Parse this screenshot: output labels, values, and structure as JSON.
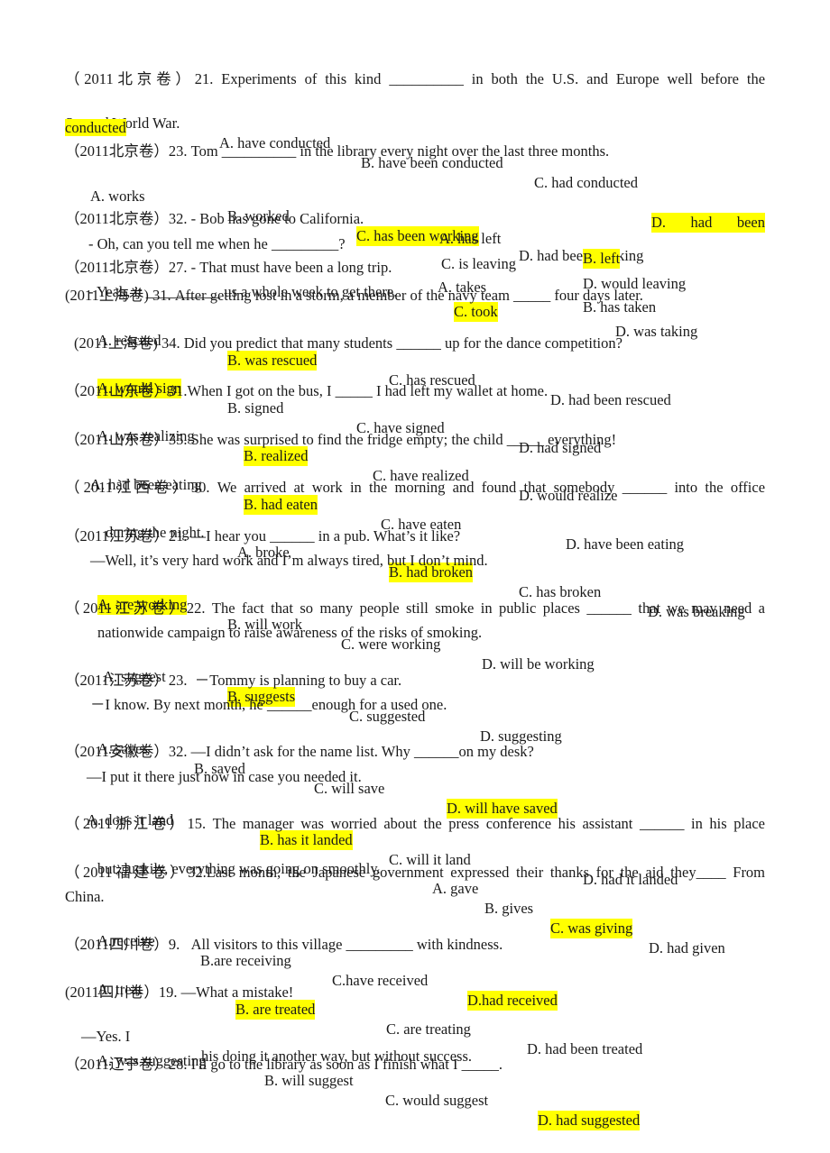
{
  "document": {
    "questions": [
      {
        "source": "（2011北京卷）",
        "number": "21.",
        "stem_before": "Experiments of this kind",
        "blank": "__________",
        "stem_after": "in both the U.S. and Europe well before the",
        "stem_line2": "Second World War.",
        "options": [
          "A. have conducted",
          "B. have been conducted",
          "C. had conducted",
          "D.    had    been",
          "conducted"
        ],
        "answer": "D"
      },
      {
        "source": "（2011北京卷）",
        "number": "23.",
        "stem_before": "Tom",
        "blank": "__________",
        "stem_after": "in the library every night over the last three months.",
        "options": [
          "A. works",
          "B. worked",
          "C. has been working",
          "D. had been working"
        ],
        "answer": "C"
      },
      {
        "source": "（2011北京卷）",
        "number": "32.",
        "stem_before": "- Bob has gone to California.",
        "stem_line2_before": "- Oh, can you tell me when he",
        "blank": "_________",
        "stem_line2_after": "?",
        "options": [
          "A. has left",
          "B. left",
          "C. is leaving",
          "D. would leaving"
        ],
        "answer": "B"
      },
      {
        "source": "（2011北京卷）",
        "number": "27.",
        "stem_before": "- That must have been a long trip.",
        "stem_line2_before": "- Yeah, it",
        "blank": "__________",
        "stem_line2_after": "us a whole week to get there.",
        "options": [
          "A. takes",
          "B. has taken",
          "C. took",
          "D. was taking"
        ],
        "answer": "C"
      },
      {
        "source": "(2011上海卷)",
        "number": "31.",
        "stem_before": "After getting lost in a storm, a member of the navy team",
        "blank": "_____",
        "stem_after": "four days later.",
        "options": [
          "A. rescued",
          "B. was rescued",
          "C. has rescued",
          "D. had been rescued"
        ],
        "answer": "B"
      },
      {
        "source": "(2011上海卷)",
        "number": "34.",
        "stem_before": "Did you predict that many students",
        "blank": "______",
        "stem_after": "up for the dance competition?",
        "options": [
          "A. would sign",
          "B. signed",
          "C. have signed",
          "D. had signed"
        ],
        "answer": "A"
      },
      {
        "source": "（2011山东卷）",
        "number": "31.",
        "stem_before": "When I got on the bus, I",
        "blank": "_____",
        "stem_after": "I had left my wallet at home.",
        "options": [
          "A. was realizing",
          "B. realized",
          "C. have realized",
          "D. would realize"
        ],
        "answer": "B"
      },
      {
        "source": "（2011山东卷）",
        "number": "35.",
        "stem_before": "She was surprised to find the fridge empty; the child",
        "blank": "_____",
        "stem_after": "everything!",
        "options": [
          "A. had been eating",
          "B. had eaten",
          "C. have eaten",
          "D. have been eating"
        ],
        "answer": "B"
      },
      {
        "source": "（2011江西卷）",
        "number": "30.",
        "stem_before": "We arrived at work in the morning and found that somebody",
        "blank": "______",
        "stem_after": "into the office",
        "stem_line2": "during the night.",
        "options": [
          "A. broke",
          "B. had broken",
          "C. has broken",
          "D. was breaking"
        ],
        "answer": "B"
      },
      {
        "source": "（2011江苏卷）",
        "number": "21.",
        "stem_before": "—I hear you",
        "blank": "______",
        "stem_after": "in a pub. What’s it like?",
        "stem_line2": "—Well, it’s very hard work and I’m always tired, but I don’t mind.",
        "options": [
          "A. are working",
          "B. will work",
          "C. were working",
          "D. will be working"
        ],
        "answer": "A"
      },
      {
        "source": "（2011江苏卷）",
        "number": "22.",
        "stem_before": "The fact that so many people still smoke in public places",
        "blank": "______",
        "stem_after": "that we may need a",
        "stem_line2": "nationwide campaign to raise awareness of the risks of smoking.",
        "options": [
          "A. suggest",
          "B. suggests",
          "C. suggested",
          "D. suggesting"
        ],
        "answer": "B"
      },
      {
        "source": "（2011江苏卷）",
        "number": "23.",
        "stem_before": "－Tommy is planning to buy a car.",
        "stem_line2_before": "－I know. By next month, he",
        "blank": "______",
        "stem_line2_after": "enough for a used one.",
        "options": [
          "A. saves",
          "B. saved",
          "C. will save",
          "D. will have saved"
        ],
        "answer": "D"
      },
      {
        "source": "（2011安徽卷）",
        "number": "32.",
        "stem_before": "—I didn’t ask for the name list. Why",
        "blank": "______",
        "stem_after": "on my desk?",
        "stem_line2": "—I put it there just now in case you needed it.",
        "options": [
          "A. does it land",
          "B. has it landed",
          "C. will it land",
          "D. had it landed"
        ],
        "answer": "B"
      },
      {
        "source": "（2011浙江卷）",
        "number": "15.",
        "stem_before": "The manager was worried about the press conference his assistant",
        "blank": "______",
        "stem_after": "in his place",
        "stem_line2": "but, luckily, everything was going on smoothly.",
        "options": [
          "A. gave",
          "B. gives",
          "C. was giving",
          "D. had given"
        ],
        "answer": "C"
      },
      {
        "source": "（2011福建卷）",
        "number": "32.",
        "stem_before": "Last month, the Japanese government expressed their thanks for the aid they",
        "blank": "____",
        "stem_after": "From",
        "stem_line2": "China.",
        "options": [
          "A.receive",
          "B.are receiving",
          "C.have received",
          "D.had received"
        ],
        "answer": "D"
      },
      {
        "source": "（2011四川卷）",
        "number": "9.",
        "stem_before": "All visitors to this village",
        "blank": "_________",
        "stem_after": "with kindness.",
        "options": [
          "A. treat",
          "B. are treated",
          "C. are treating",
          "D. had been treated"
        ],
        "answer": "B"
      },
      {
        "source": "(2011四川卷）",
        "number": "19.",
        "stem_before": "—What a mistake!",
        "stem_line2_before": "—Yes. I",
        "stem_line2_after": "his doing it another way, but without success.",
        "options": [
          "A. was suggesting",
          "B. will suggest",
          "C. would suggest",
          "D. had suggested"
        ],
        "answer": "D"
      },
      {
        "source": "（2011辽宁卷）",
        "number": "28.",
        "stem_before": "I'll go to the library as soon as I finish what I",
        "blank": "_____",
        "stem_after": "."
      }
    ],
    "highlight_color": "#ffff00"
  }
}
